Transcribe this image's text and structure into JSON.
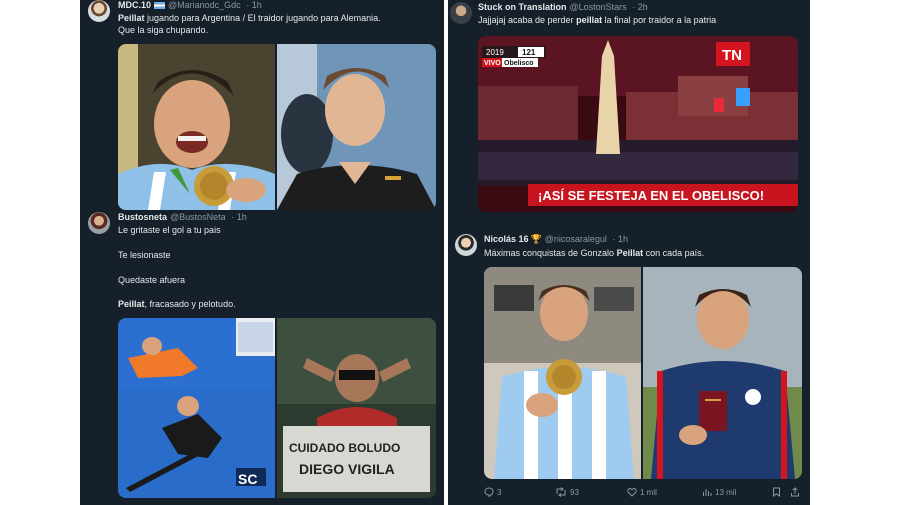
{
  "colors": {
    "background": "#15202b",
    "text": "#e7e9ea",
    "secondary": "#8b98a5"
  },
  "tweets": [
    {
      "name": "MDC.10",
      "handle": "@Marianodc_Gdc",
      "time": "· 1h",
      "line1_bold": "Peillat",
      "line1_rest": " jugando para Argentina / El traidor jugando para Alemania.",
      "line2": "Que la siga chupando."
    },
    {
      "name": "Stuck on Translation",
      "handle": "@LostonStars",
      "time": "· 2h",
      "text_pre": "Jajjajaj acaba de perder ",
      "text_bold": "peillat",
      "text_post": " la final por traidor a la patria",
      "tv_caption": "¡ASÍ SE FESTEJA EN EL OBELISCO!",
      "tv_vivo": "VIVO",
      "tv_place": "Obelisco",
      "tv_year": "2019",
      "tv_channel": "121",
      "tv_logo": "TN"
    },
    {
      "name": "Bustosneta",
      "handle": "@BustosNeta",
      "time": "· 1h",
      "line1": "Le gritaste el gol a tu pais",
      "line2": "Te lesionaste",
      "line3": "Quedaste afuera",
      "line4_bold": "Peillat",
      "line4_rest": ", fracasado y pelotudo.",
      "banner_line1": "CUIDADO  BOLUDO",
      "banner_line2": "DIEGO  VIGILA",
      "sc_logo": "SC"
    },
    {
      "name": "Nicolás 16",
      "trophy": "🏆",
      "handle": "@nicosaralegul",
      "time": "· 1h",
      "text_pre": "Máximas conquistas de Gonzalo ",
      "text_bold": "Peillat",
      "text_post": " con cada país.",
      "actions": {
        "replies": "3",
        "retweets": "93",
        "likes": "1 mil",
        "views": "13 mil"
      }
    }
  ]
}
